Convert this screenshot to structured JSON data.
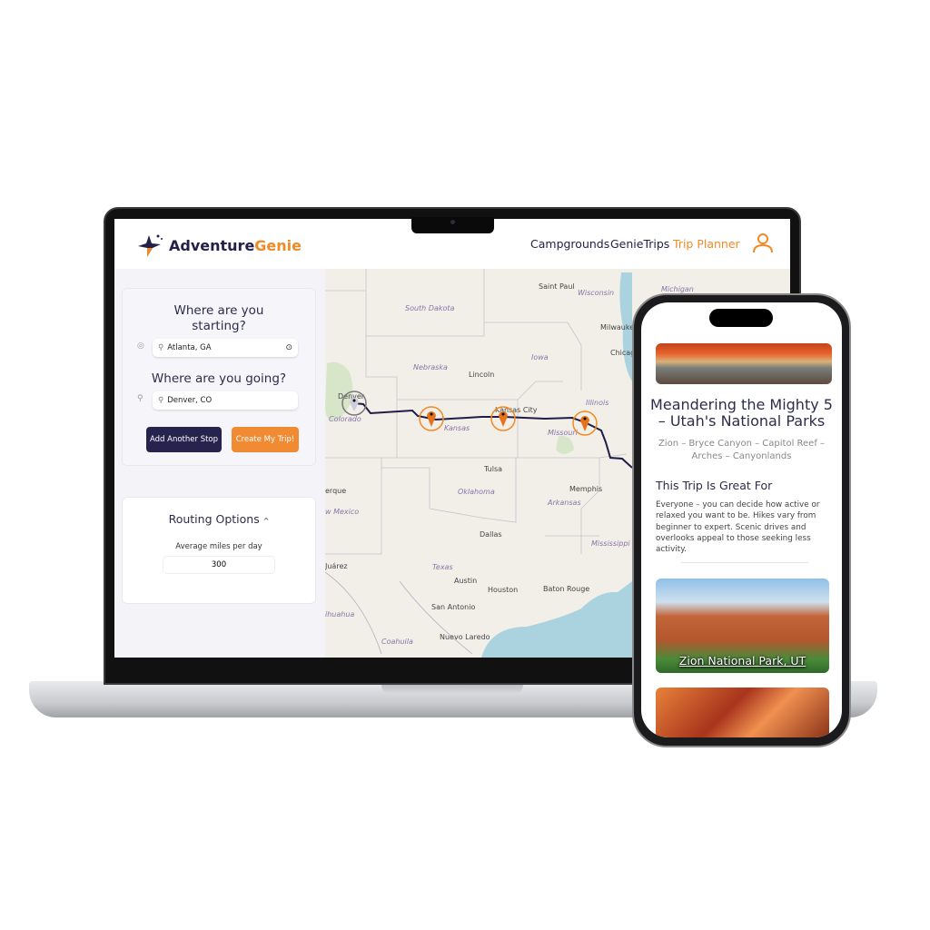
{
  "brand": {
    "name_a": "Adventure",
    "name_b": "Genie",
    "accent": "#f08a24",
    "navy": "#23214a"
  },
  "nav": [
    {
      "label": "Campgrounds"
    },
    {
      "label": "GenieTrips"
    },
    {
      "label": "Trip Planner",
      "active": true
    }
  ],
  "planner": {
    "start_q": "Where are you starting?",
    "start_value": "Atlanta, GA",
    "dest_q": "Where are you going?",
    "dest_value": "Denver, CO",
    "add_stop": "Add Another Stop",
    "create": "Create My Trip!"
  },
  "routing": {
    "title": "Routing Options",
    "miles_label": "Average miles per day",
    "miles_value": "300"
  },
  "map": {
    "labels": [
      "Saint Paul",
      "Wisconsin",
      "Michigan",
      "South Dakota",
      "Milwaukee",
      "Iowa",
      "Chicago",
      "Nebraska",
      "Lincoln",
      "Denver",
      "Colorado",
      "Kansas City",
      "Illinois",
      "Kansas",
      "Missouri",
      "Tulsa",
      "Oklahoma",
      "Memphis",
      "Arkansas",
      "erque",
      "w Mexico",
      "Dallas",
      "Mississippi",
      "Texas",
      "Juárez",
      "Austin",
      "Houston",
      "Baton Rouge",
      "San Antonio",
      "ihuahua",
      "Coahuila",
      "Nuevo Laredo"
    ]
  },
  "phone": {
    "title": "Meandering the Mighty 5 – Utah's National Parks",
    "subtitle": "Zion – Bryce Canyon – Capitol Reef – Arches – Canyonlands",
    "section": "This Trip Is Great For",
    "body": "Everyone – you can decide how active or relaxed you want to be. Hikes vary from beginner to expert. Scenic drives and overlooks appeal to those seeking less activity.",
    "card1": "Zion National Park, UT"
  }
}
